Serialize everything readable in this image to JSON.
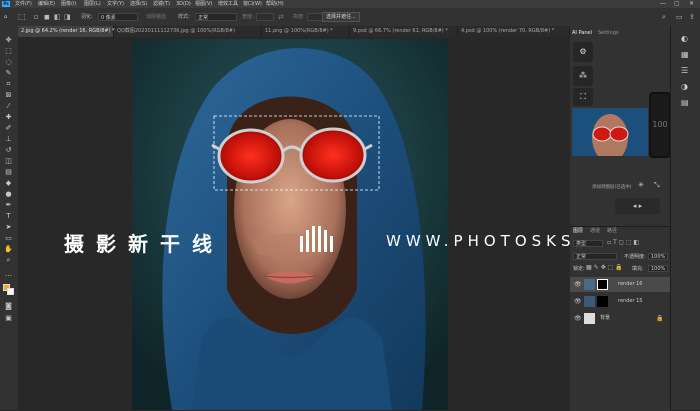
{
  "menu": {
    "app_icon": "Ps",
    "items": [
      "文件(F)",
      "编辑(E)",
      "图像(I)",
      "图层(L)",
      "文字(Y)",
      "选择(S)",
      "滤镜(T)",
      "3D(D)",
      "视图(V)",
      "增效工具",
      "窗口(W)",
      "帮助(H)"
    ]
  },
  "options": {
    "feather_label": "羽化:",
    "feather_value": "0 像素",
    "antialias_label": "消除锯齿",
    "style_label": "样式:",
    "style_value": "正常",
    "width_label": "宽度:",
    "height_label": "高度:",
    "select_mask_button": "选择并遮住..."
  },
  "tabs": [
    {
      "label": "2.jpg @ 64.2% (render 16, RGB/8#) *"
    },
    {
      "label": "QQ截图20230111112736.jpg @ 100%(RGB/8#)"
    },
    {
      "label": "11.png @ 100%(RGB/8#) *"
    },
    {
      "label": "9.psd @ 66.7% (render 61, RGB/8#) *"
    },
    {
      "label": "4.psd @ 100% (render 70, RGB/8#) *"
    }
  ],
  "watermark": {
    "cn_text": "摄影新干线",
    "url": "WWW.PHOTOSKS.VIP"
  },
  "ai_panel": {
    "tab1": "AI Panel",
    "tab2": "Settings",
    "value": "100",
    "footer_text": "添加到图层(已选中)"
  },
  "layers_panel": {
    "tabs": [
      "图层",
      "通道",
      "路径"
    ],
    "kind_label": "类型",
    "blend_mode": "正常",
    "opacity_label": "不透明度:",
    "opacity_value": "100%",
    "lock_label": "锁定:",
    "fill_label": "填充:",
    "fill_value": "100%",
    "layers": [
      {
        "name": "render 16",
        "selected": true
      },
      {
        "name": "render 15",
        "selected": false
      },
      {
        "name": "背景",
        "selected": false
      }
    ]
  },
  "colors": {
    "foreground": "#f5a623",
    "background": "#ffffff",
    "accent": "#31a8ff"
  }
}
